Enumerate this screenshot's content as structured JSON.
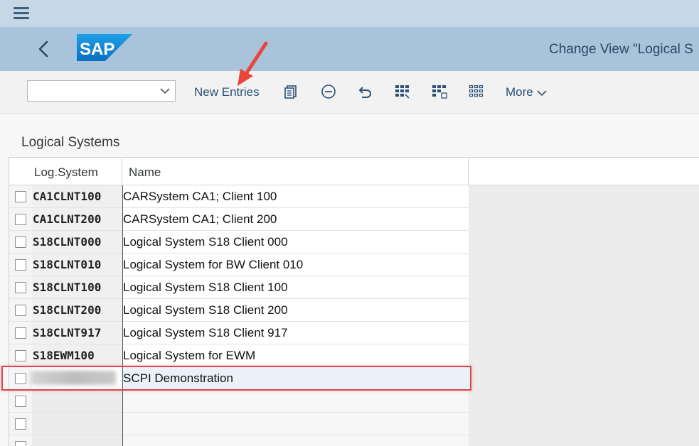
{
  "header": {
    "title": "Change View \"Logical S"
  },
  "toolbar": {
    "select_value": "",
    "new_entries_label": "New Entries",
    "more_label": "More",
    "icons": [
      "copy-icon",
      "delete-icon",
      "undo-icon",
      "select-all-icon",
      "select-block-icon",
      "deselect-all-icon"
    ]
  },
  "section": {
    "title": "Logical Systems"
  },
  "table": {
    "columns": [
      "Log.System",
      "Name"
    ],
    "rows": [
      {
        "log_system": "CA1CLNT100",
        "name": "CARSystem CA1; Client 100"
      },
      {
        "log_system": "CA1CLNT200",
        "name": "CARSystem CA1; Client 200"
      },
      {
        "log_system": "S18CLNT000",
        "name": "Logical System S18 Client 000"
      },
      {
        "log_system": "S18CLNT010",
        "name": "Logical System for BW Client 010"
      },
      {
        "log_system": "S18CLNT100",
        "name": "Logical System S18 Client 100"
      },
      {
        "log_system": "S18CLNT200",
        "name": "Logical System S18 Client 200"
      },
      {
        "log_system": "S18CLNT917",
        "name": "Logical System S18 Client 917"
      },
      {
        "log_system": "S18EWM100",
        "name": "Logical System for EWM"
      },
      {
        "log_system": "",
        "name": "SCPI Demonstration"
      }
    ]
  },
  "colors": {
    "shell": "#a8c3da",
    "topbar": "#c6d7e6",
    "link": "#2c5178",
    "annotation": "#e0444a",
    "sap_blue": "#1a8fd8"
  }
}
